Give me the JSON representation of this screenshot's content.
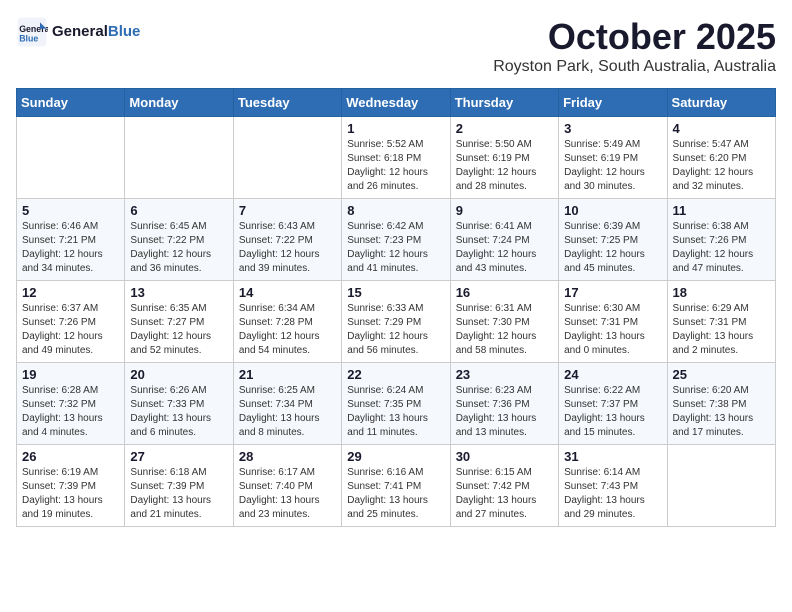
{
  "logo": {
    "line1": "General",
    "line2": "Blue"
  },
  "title": "October 2025",
  "location": "Royston Park, South Australia, Australia",
  "days_of_week": [
    "Sunday",
    "Monday",
    "Tuesday",
    "Wednesday",
    "Thursday",
    "Friday",
    "Saturday"
  ],
  "weeks": [
    [
      {
        "day": "",
        "info": ""
      },
      {
        "day": "",
        "info": ""
      },
      {
        "day": "",
        "info": ""
      },
      {
        "day": "1",
        "info": "Sunrise: 5:52 AM\nSunset: 6:18 PM\nDaylight: 12 hours\nand 26 minutes."
      },
      {
        "day": "2",
        "info": "Sunrise: 5:50 AM\nSunset: 6:19 PM\nDaylight: 12 hours\nand 28 minutes."
      },
      {
        "day": "3",
        "info": "Sunrise: 5:49 AM\nSunset: 6:19 PM\nDaylight: 12 hours\nand 30 minutes."
      },
      {
        "day": "4",
        "info": "Sunrise: 5:47 AM\nSunset: 6:20 PM\nDaylight: 12 hours\nand 32 minutes."
      }
    ],
    [
      {
        "day": "5",
        "info": "Sunrise: 6:46 AM\nSunset: 7:21 PM\nDaylight: 12 hours\nand 34 minutes."
      },
      {
        "day": "6",
        "info": "Sunrise: 6:45 AM\nSunset: 7:22 PM\nDaylight: 12 hours\nand 36 minutes."
      },
      {
        "day": "7",
        "info": "Sunrise: 6:43 AM\nSunset: 7:22 PM\nDaylight: 12 hours\nand 39 minutes."
      },
      {
        "day": "8",
        "info": "Sunrise: 6:42 AM\nSunset: 7:23 PM\nDaylight: 12 hours\nand 41 minutes."
      },
      {
        "day": "9",
        "info": "Sunrise: 6:41 AM\nSunset: 7:24 PM\nDaylight: 12 hours\nand 43 minutes."
      },
      {
        "day": "10",
        "info": "Sunrise: 6:39 AM\nSunset: 7:25 PM\nDaylight: 12 hours\nand 45 minutes."
      },
      {
        "day": "11",
        "info": "Sunrise: 6:38 AM\nSunset: 7:26 PM\nDaylight: 12 hours\nand 47 minutes."
      }
    ],
    [
      {
        "day": "12",
        "info": "Sunrise: 6:37 AM\nSunset: 7:26 PM\nDaylight: 12 hours\nand 49 minutes."
      },
      {
        "day": "13",
        "info": "Sunrise: 6:35 AM\nSunset: 7:27 PM\nDaylight: 12 hours\nand 52 minutes."
      },
      {
        "day": "14",
        "info": "Sunrise: 6:34 AM\nSunset: 7:28 PM\nDaylight: 12 hours\nand 54 minutes."
      },
      {
        "day": "15",
        "info": "Sunrise: 6:33 AM\nSunset: 7:29 PM\nDaylight: 12 hours\nand 56 minutes."
      },
      {
        "day": "16",
        "info": "Sunrise: 6:31 AM\nSunset: 7:30 PM\nDaylight: 12 hours\nand 58 minutes."
      },
      {
        "day": "17",
        "info": "Sunrise: 6:30 AM\nSunset: 7:31 PM\nDaylight: 13 hours\nand 0 minutes."
      },
      {
        "day": "18",
        "info": "Sunrise: 6:29 AM\nSunset: 7:31 PM\nDaylight: 13 hours\nand 2 minutes."
      }
    ],
    [
      {
        "day": "19",
        "info": "Sunrise: 6:28 AM\nSunset: 7:32 PM\nDaylight: 13 hours\nand 4 minutes."
      },
      {
        "day": "20",
        "info": "Sunrise: 6:26 AM\nSunset: 7:33 PM\nDaylight: 13 hours\nand 6 minutes."
      },
      {
        "day": "21",
        "info": "Sunrise: 6:25 AM\nSunset: 7:34 PM\nDaylight: 13 hours\nand 8 minutes."
      },
      {
        "day": "22",
        "info": "Sunrise: 6:24 AM\nSunset: 7:35 PM\nDaylight: 13 hours\nand 11 minutes."
      },
      {
        "day": "23",
        "info": "Sunrise: 6:23 AM\nSunset: 7:36 PM\nDaylight: 13 hours\nand 13 minutes."
      },
      {
        "day": "24",
        "info": "Sunrise: 6:22 AM\nSunset: 7:37 PM\nDaylight: 13 hours\nand 15 minutes."
      },
      {
        "day": "25",
        "info": "Sunrise: 6:20 AM\nSunset: 7:38 PM\nDaylight: 13 hours\nand 17 minutes."
      }
    ],
    [
      {
        "day": "26",
        "info": "Sunrise: 6:19 AM\nSunset: 7:39 PM\nDaylight: 13 hours\nand 19 minutes."
      },
      {
        "day": "27",
        "info": "Sunrise: 6:18 AM\nSunset: 7:39 PM\nDaylight: 13 hours\nand 21 minutes."
      },
      {
        "day": "28",
        "info": "Sunrise: 6:17 AM\nSunset: 7:40 PM\nDaylight: 13 hours\nand 23 minutes."
      },
      {
        "day": "29",
        "info": "Sunrise: 6:16 AM\nSunset: 7:41 PM\nDaylight: 13 hours\nand 25 minutes."
      },
      {
        "day": "30",
        "info": "Sunrise: 6:15 AM\nSunset: 7:42 PM\nDaylight: 13 hours\nand 27 minutes."
      },
      {
        "day": "31",
        "info": "Sunrise: 6:14 AM\nSunset: 7:43 PM\nDaylight: 13 hours\nand 29 minutes."
      },
      {
        "day": "",
        "info": ""
      }
    ]
  ]
}
